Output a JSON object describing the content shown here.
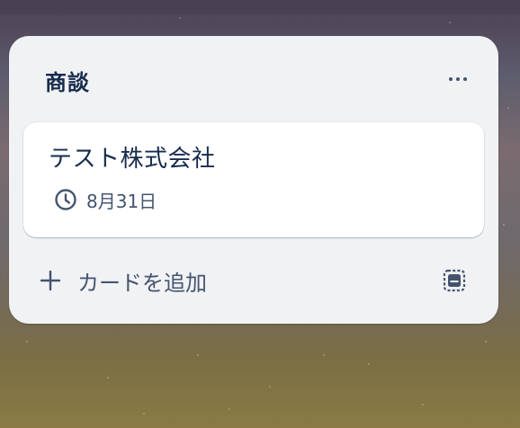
{
  "list": {
    "title": "商談",
    "menu_icon": "more-horizontal-icon"
  },
  "cards": [
    {
      "title": "テスト株式会社",
      "due_icon": "clock-icon",
      "due_date": "8月31日"
    }
  ],
  "footer": {
    "add_icon": "plus-icon",
    "add_label": "カードを追加",
    "template_icon": "card-template-icon"
  },
  "colors": {
    "list_bg": "#f1f2f4",
    "card_bg": "#ffffff",
    "title_text": "#172b4d",
    "secondary_text": "#44546f"
  }
}
